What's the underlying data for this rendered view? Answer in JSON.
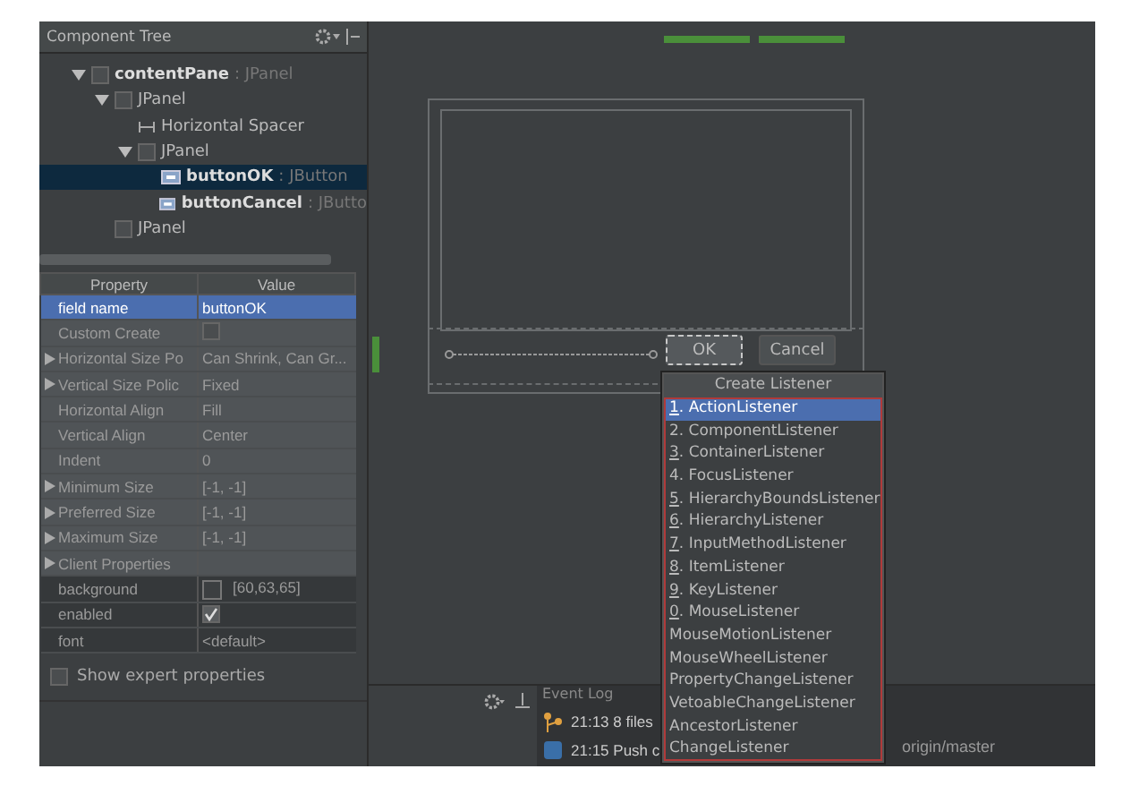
{
  "component_tree": {
    "title": "Component Tree",
    "items": [
      {
        "name": "contentPane",
        "type": ": JPanel",
        "kind": "panel",
        "bound": true,
        "expanded": true,
        "selected": false,
        "children": [
          {
            "name": "JPanel",
            "kind": "panel",
            "bound": false,
            "expanded": true,
            "selected": false,
            "children": [
              {
                "name": "Horizontal Spacer",
                "kind": "spacer",
                "bound": false,
                "selected": false
              },
              {
                "name": "JPanel",
                "kind": "panel",
                "bound": false,
                "expanded": true,
                "selected": false,
                "children": [
                  {
                    "name": "buttonOK",
                    "type": ": JButton",
                    "kind": "button",
                    "bound": true,
                    "selected": true
                  },
                  {
                    "name": "buttonCancel",
                    "type": ": JButto",
                    "kind": "button",
                    "bound": true,
                    "selected": false
                  }
                ]
              }
            ]
          },
          {
            "name": "JPanel",
            "kind": "panel",
            "bound": false,
            "selected": false
          }
        ]
      }
    ]
  },
  "properties": {
    "columns": [
      "Property",
      "Value"
    ],
    "rows": [
      {
        "name": "field name",
        "value": "buttonOK",
        "kind": "text",
        "selected": true,
        "expandable": false
      },
      {
        "name": "Custom Create",
        "kind": "checkbox",
        "checked": false,
        "selected": false,
        "expandable": false,
        "grouped": true
      },
      {
        "name": "Horizontal Size Po",
        "value": "Can Shrink, Can Gr...",
        "kind": "text",
        "selected": false,
        "expandable": true,
        "grouped": true
      },
      {
        "name": "Vertical Size Polic",
        "value": "Fixed",
        "kind": "text",
        "selected": false,
        "expandable": true,
        "grouped": true
      },
      {
        "name": "Horizontal Align",
        "value": "Fill",
        "kind": "text",
        "selected": false,
        "expandable": false,
        "grouped": true
      },
      {
        "name": "Vertical Align",
        "value": "Center",
        "kind": "text",
        "selected": false,
        "expandable": false,
        "grouped": true
      },
      {
        "name": "Indent",
        "value": "0",
        "kind": "text",
        "selected": false,
        "expandable": false,
        "grouped": true
      },
      {
        "name": "Minimum Size",
        "value": "[-1, -1]",
        "kind": "text",
        "selected": false,
        "expandable": true,
        "grouped": true
      },
      {
        "name": "Preferred Size",
        "value": "[-1, -1]",
        "kind": "text",
        "selected": false,
        "expandable": true,
        "grouped": true
      },
      {
        "name": "Maximum Size",
        "value": "[-1, -1]",
        "kind": "text",
        "selected": false,
        "expandable": true,
        "grouped": true
      },
      {
        "name": "Client Properties",
        "kind": "text",
        "selected": false,
        "expandable": true,
        "grouped": true
      },
      {
        "name": "background",
        "value": "[60,63,65]",
        "kind": "color",
        "color": "#3c3f41",
        "selected": false,
        "expandable": false,
        "grouped": false
      },
      {
        "name": "enabled",
        "kind": "checkbox",
        "checked": true,
        "selected": false,
        "expandable": false,
        "grouped": false
      },
      {
        "name": "font",
        "value": "<default>",
        "kind": "text",
        "selected": false,
        "expandable": false,
        "grouped": false
      }
    ],
    "expert": {
      "label": "Show expert properties",
      "checked": false
    }
  },
  "designer": {
    "buttons": [
      {
        "label": "OK",
        "selected": true
      },
      {
        "label": "Cancel",
        "selected": false
      }
    ]
  },
  "listener_menu": {
    "title": "Create Listener",
    "items": [
      {
        "label": "1. ActionListener",
        "underlined": true,
        "selected": true
      },
      {
        "label": "2. ComponentListener",
        "underlined": false,
        "selected": false
      },
      {
        "label": "3. ContainerListener",
        "underlined": true,
        "selected": false
      },
      {
        "label": "4. FocusListener",
        "underlined": false,
        "selected": false
      },
      {
        "label": "5. HierarchyBoundsListener",
        "underlined": true,
        "selected": false
      },
      {
        "label": "6. HierarchyListener",
        "underlined": true,
        "selected": false
      },
      {
        "label": "7. InputMethodListener",
        "underlined": true,
        "selected": false
      },
      {
        "label": "8. ItemListener",
        "underlined": true,
        "selected": false
      },
      {
        "label": "9. KeyListener",
        "underlined": true,
        "selected": false
      },
      {
        "label": "0. MouseListener",
        "underlined": true,
        "selected": false
      },
      {
        "label": "MouseMotionListener",
        "underlined": false,
        "selected": false
      },
      {
        "label": "MouseWheelListener",
        "underlined": false,
        "selected": false
      },
      {
        "label": "PropertyChangeListener",
        "underlined": false,
        "selected": false
      },
      {
        "label": "VetoableChangeListener",
        "underlined": false,
        "selected": false
      },
      {
        "label": "AncestorListener",
        "underlined": false,
        "selected": false
      },
      {
        "label": "ChangeListener",
        "underlined": false,
        "selected": false
      }
    ]
  },
  "event_log": {
    "title": "Event Log",
    "entries": [
      {
        "time": "21:13",
        "text": "8 files",
        "kind": "vcs"
      },
      {
        "time": "21:15",
        "text": "Push c",
        "tail": "origin/master",
        "kind": "push"
      }
    ]
  }
}
